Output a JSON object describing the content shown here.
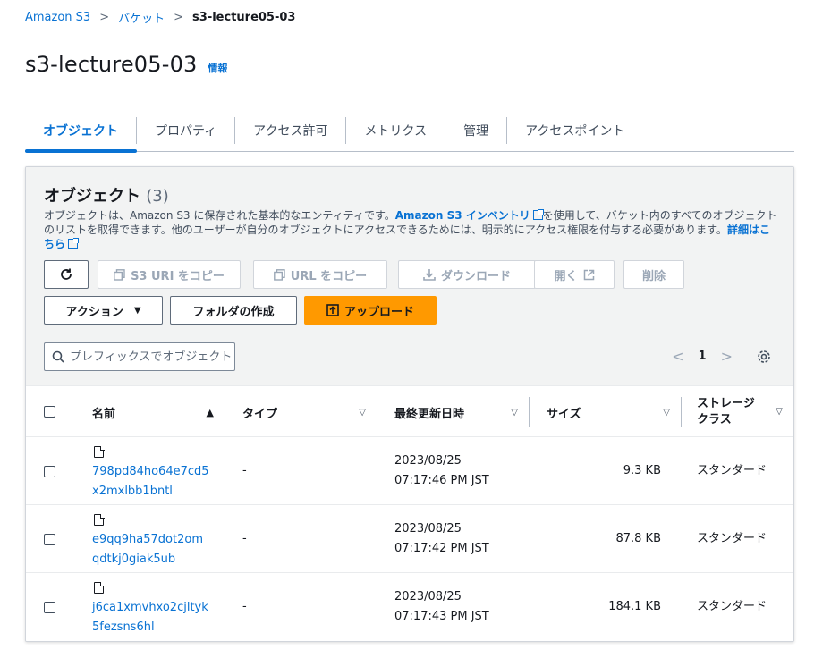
{
  "breadcrumb": {
    "root": "Amazon S3",
    "middle": "バケット",
    "current": "s3-lecture05-03"
  },
  "page": {
    "title": "s3-lecture05-03",
    "info": "情報"
  },
  "tabs": [
    "オブジェクト",
    "プロパティ",
    "アクセス許可",
    "メトリクス",
    "管理",
    "アクセスポイント"
  ],
  "panel": {
    "title": "オブジェクト",
    "count": "(3)",
    "desc_pre": "オブジェクトは、Amazon S3 に保存された基本的なエンティティです。",
    "desc_link1": "Amazon S3 インベントリ",
    "desc_mid": "を使用して、バケット内のすべてのオブジェクトのリストを取得できます。他のユーザーが自分のオブジェクトにアクセスできるためには、明示的にアクセス権限を付与する必要があります。",
    "desc_link2": "詳細はこちら"
  },
  "buttons": {
    "refresh": "",
    "copy_s3_uri": "S3 URI をコピー",
    "copy_url": "URL をコピー",
    "download": "ダウンロード",
    "open": "開く",
    "delete": "削除",
    "actions": "アクション",
    "create_folder": "フォルダの作成",
    "upload": "アップロード"
  },
  "search": {
    "placeholder": "プレフィックスでオブジェクトを検索"
  },
  "pager": {
    "page": "1"
  },
  "table": {
    "headers": {
      "name": "名前",
      "type": "タイプ",
      "modified": "最終更新日時",
      "size": "サイズ",
      "storage1": "ストレージ",
      "storage2": "クラス"
    },
    "rows": [
      {
        "name1": "798pd84ho64e7cd5",
        "name2": "x2mxlbb1bntl",
        "type": "-",
        "date": "2023/08/25",
        "time": "07:17:46 PM JST",
        "size": "9.3 KB",
        "storage": "スタンダード"
      },
      {
        "name1": "e9qq9ha57dot2om",
        "name2": "qdtkj0giak5ub",
        "type": "-",
        "date": "2023/08/25",
        "time": "07:17:42 PM JST",
        "size": "87.8 KB",
        "storage": "スタンダード"
      },
      {
        "name1": "j6ca1xmvhxo2cjltyk",
        "name2": "5fezsns6hl",
        "type": "-",
        "date": "2023/08/25",
        "time": "07:17:43 PM JST",
        "size": "184.1 KB",
        "storage": "スタンダード"
      }
    ]
  }
}
